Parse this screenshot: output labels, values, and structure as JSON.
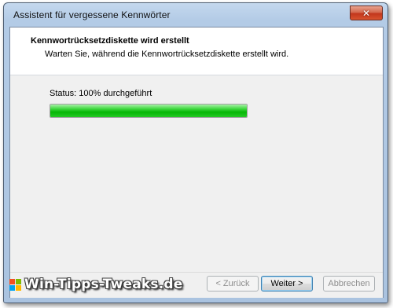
{
  "window": {
    "title": "Assistent für vergessene Kennwörter",
    "close_glyph": "✕"
  },
  "header": {
    "title": "Kennwortrücksetzdiskette wird erstellt",
    "subtitle": "Warten Sie, während die Kennwortrücksetzdiskette erstellt wird."
  },
  "body": {
    "status_text": "Status: 100% durchgeführt",
    "progress_fraction": 1.0,
    "progress_color": "#06b606"
  },
  "footer": {
    "back_label": "< Zurück",
    "next_label": "Weiter >",
    "cancel_label": "Abbrechen"
  },
  "watermark": {
    "text": "Win-Tipps-Tweaks.de",
    "logo_icon": "windows-flag-icon",
    "logo_colors": [
      "#f25022",
      "#7fba00",
      "#00a4ef",
      "#ffb900"
    ]
  }
}
